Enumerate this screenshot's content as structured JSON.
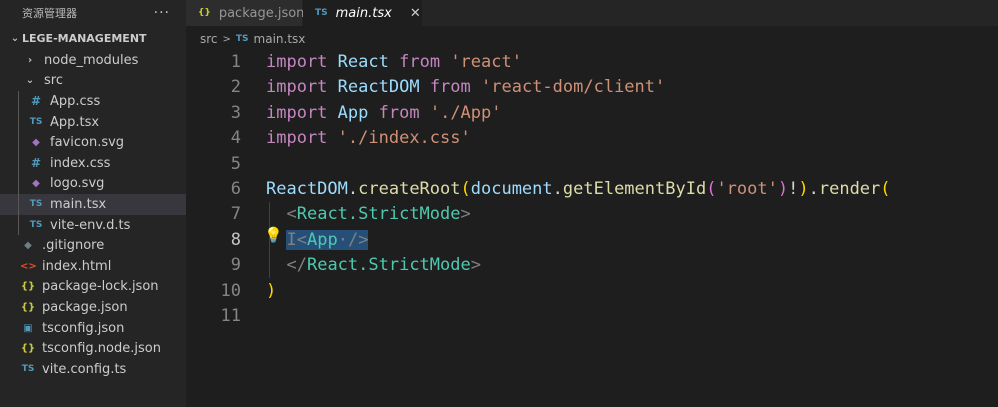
{
  "sidebar": {
    "title": "资源管理器",
    "more": "···",
    "root": "LEGE-MANAGEMENT",
    "items": [
      {
        "label": "node_modules",
        "icon": "chevron-right-icon",
        "glyph": "›"
      },
      {
        "label": "src",
        "icon": "chevron-down-icon",
        "glyph": "⌄"
      },
      {
        "label": "App.css",
        "icon": "css-file-icon",
        "glyph": "#"
      },
      {
        "label": "App.tsx",
        "icon": "typescript-file-icon",
        "glyph": "TS"
      },
      {
        "label": "favicon.svg",
        "icon": "svg-file-icon",
        "glyph": "◆"
      },
      {
        "label": "index.css",
        "icon": "css-file-icon",
        "glyph": "#"
      },
      {
        "label": "logo.svg",
        "icon": "svg-file-icon",
        "glyph": "◆"
      },
      {
        "label": "main.tsx",
        "icon": "typescript-file-icon",
        "glyph": "TS"
      },
      {
        "label": "vite-env.d.ts",
        "icon": "typescript-file-icon",
        "glyph": "TS"
      },
      {
        "label": ".gitignore",
        "icon": "git-file-icon",
        "glyph": "◆"
      },
      {
        "label": "index.html",
        "icon": "html-file-icon",
        "glyph": "<>"
      },
      {
        "label": "package-lock.json",
        "icon": "json-file-icon",
        "glyph": "{}"
      },
      {
        "label": "package.json",
        "icon": "json-file-icon",
        "glyph": "{}"
      },
      {
        "label": "tsconfig.json",
        "icon": "tsconfig-file-icon",
        "glyph": "▣"
      },
      {
        "label": "tsconfig.node.json",
        "icon": "json-file-icon",
        "glyph": "{}"
      },
      {
        "label": "vite.config.ts",
        "icon": "typescript-file-icon",
        "glyph": "TS"
      }
    ],
    "selected": "main.tsx"
  },
  "tabs": [
    {
      "label": "package.json",
      "icon": "{}",
      "active": false
    },
    {
      "label": "main.tsx",
      "icon": "TS",
      "active": true,
      "close": "✕"
    }
  ],
  "breadcrumb": {
    "folder": "src",
    "sep": ">",
    "icon": "TS",
    "file": "main.tsx"
  },
  "editor": {
    "line_numbers": [
      "1",
      "2",
      "3",
      "4",
      "5",
      "6",
      "7",
      "8",
      "9",
      "10",
      "11"
    ],
    "current_line": "8",
    "code": {
      "l1": {
        "kw": "import",
        "name": "React",
        "from": "from",
        "str": "'react'"
      },
      "l2": {
        "kw": "import",
        "name": "ReactDOM",
        "from": "from",
        "str": "'react-dom/client'"
      },
      "l3": {
        "kw": "import",
        "name": "App",
        "from": "from",
        "str": "'./App'"
      },
      "l4": {
        "kw": "import",
        "str": "'./index.css'"
      },
      "l6": {
        "obj": "ReactDOM",
        "dot": ".",
        "fn": "createRoot",
        "p1": "(",
        "doc": "document",
        "dot2": ".",
        "fn2": "getElementById",
        "p2": "(",
        "str": "'root'",
        "p3": ")",
        "bang": "!",
        "p4": ")",
        "dot3": ".",
        "fn3": "render",
        "p5": "("
      },
      "l7": {
        "open": "<",
        "tag": "React.StrictMode",
        "close": ">"
      },
      "l8": {
        "cursor": "I",
        "open": "<",
        "tag": "App",
        "dot": "·",
        "close": "/>"
      },
      "l9": {
        "open": "</",
        "tag": "React.StrictMode",
        "close": ">"
      },
      "l10": {
        "paren": ")"
      }
    }
  },
  "colors": {
    "keyword": "#c586c0",
    "variable": "#9cdcfe",
    "string": "#ce9178",
    "function": "#dcdcaa",
    "tag": "#4ec9b0",
    "selection": "#264f78"
  }
}
